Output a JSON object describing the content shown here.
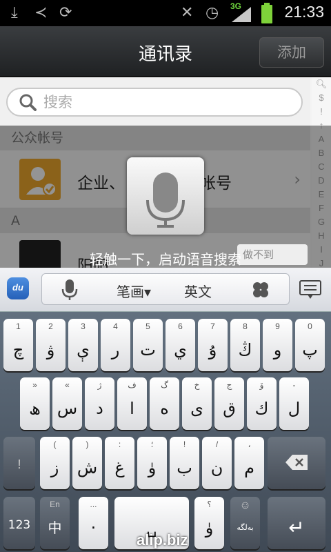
{
  "status_bar": {
    "network_label": "3G",
    "time": "21:33",
    "icons": [
      "download-icon",
      "share-icon",
      "sync-icon",
      "mute-icon",
      "alarm-icon",
      "signal-icon",
      "battery-icon"
    ]
  },
  "title_bar": {
    "title": "通讯录",
    "add_label": "添加"
  },
  "search": {
    "placeholder": "搜索"
  },
  "sections": {
    "public_accounts": "公众帐号",
    "letter_a": "A"
  },
  "rows": {
    "enterprise_text_left": "企业、",
    "enterprise_text_right": "帐号",
    "contact_name": "阳阳"
  },
  "alpha_index": [
    "$",
    "!",
    "↑",
    "A",
    "B",
    "C",
    "D",
    "E",
    "F",
    "G",
    "H",
    "I",
    "J"
  ],
  "voice": {
    "hint": "轻触一下，启动语音搜索",
    "tip_bubble": "做不到"
  },
  "ime_bar": {
    "logo": "du",
    "stroke_label": "笔画▾",
    "english_label": "英文"
  },
  "keyboard": {
    "row1": [
      {
        "sup": "1",
        "main": "چ"
      },
      {
        "sup": "2",
        "main": "ۋ"
      },
      {
        "sup": "3",
        "main": "ې"
      },
      {
        "sup": "4",
        "main": "ر"
      },
      {
        "sup": "5",
        "main": "ت"
      },
      {
        "sup": "6",
        "main": "ي"
      },
      {
        "sup": "7",
        "main": "ۇ"
      },
      {
        "sup": "8",
        "main": "ڭ"
      },
      {
        "sup": "9",
        "main": "و"
      },
      {
        "sup": "0",
        "main": "پ"
      }
    ],
    "row2": [
      {
        "sup": "»",
        "main": "ھ"
      },
      {
        "sup": "«",
        "main": "س"
      },
      {
        "sup": "ژ",
        "main": "د"
      },
      {
        "sup": "ف",
        "main": "ا"
      },
      {
        "sup": "گ",
        "main": "ە"
      },
      {
        "sup": "خ",
        "main": "ى"
      },
      {
        "sup": "ج",
        "main": "ق"
      },
      {
        "sup": "ۆ",
        "main": "ك"
      },
      {
        "sup": "-",
        "main": "ل"
      }
    ],
    "row3": [
      {
        "sup": "!",
        "main": ""
      },
      {
        "sup": "(",
        "main": "ز"
      },
      {
        "sup": ")",
        "main": "ش"
      },
      {
        "sup": ":",
        "main": "غ"
      },
      {
        "sup": "؛",
        "main": "ۈ"
      },
      {
        "sup": "!",
        "main": "ب"
      },
      {
        "sup": "/",
        "main": "ن"
      },
      {
        "sup": "،",
        "main": "م"
      }
    ],
    "row4": {
      "num_label": "123",
      "lang_sup": "En",
      "lang_main": "中",
      "dots_sup": "...",
      "dots_main": "·",
      "space_label": "␣",
      "q_sup": "؟",
      "q_main": "ۈ",
      "emoji_sup": "☺",
      "emoji_main": "ﺑﻪﻟﮕﻪ",
      "enter_label": "↵"
    }
  },
  "watermark": "alip.biz"
}
